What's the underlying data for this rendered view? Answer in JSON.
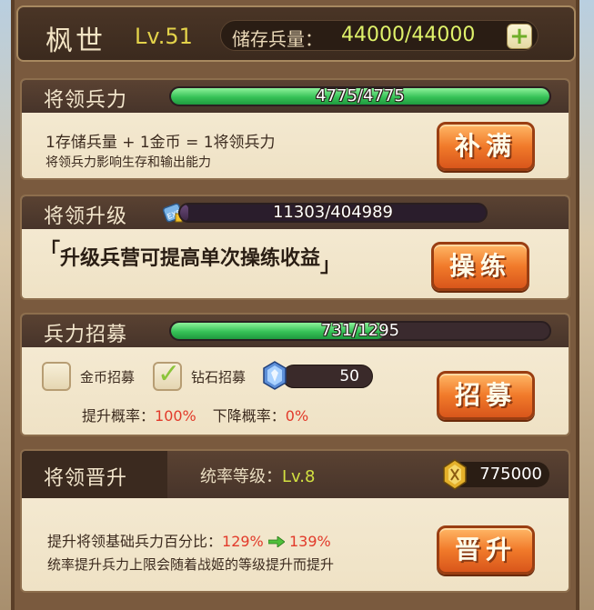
{
  "header": {
    "hero_name": "枫世",
    "level": "Lv.51",
    "storage_label": "储存兵量：",
    "storage_value": "44000/44000",
    "plus_icon": "plus-icon"
  },
  "troops": {
    "title": "将领兵力",
    "bar_text": "4775/4775",
    "bar_fraction": 1.0,
    "line1": "1存储兵量 + 1金币 = 1将领兵力",
    "line2": "将领兵力影响生存和输出能力",
    "button": "补满"
  },
  "upgrade": {
    "title": "将领升级",
    "exp_icon": "exp-icon",
    "bar_text": "11303/404989",
    "bar_fraction": 0.028,
    "tip_open": "「",
    "tip": "升级兵营可提高单次操练收益",
    "tip_close": "」",
    "button": "操练"
  },
  "recruit": {
    "title": "兵力招募",
    "bar_text": "731/1295",
    "bar_fraction": 0.564,
    "gold_label": "金币招募",
    "gold_checked": false,
    "diamond_label": "钻石招募",
    "diamond_checked": true,
    "diamond_count": "50",
    "up_label": "提升概率：",
    "up_value": "100%",
    "down_label": "下降概率：",
    "down_value": "0%",
    "button": "招募"
  },
  "promote": {
    "title": "将领晋升",
    "command_label": "统率等级：",
    "command_value": "Lv.8",
    "coin_count": "775000",
    "line1_label": "提升将领基础兵力百分比：",
    "from": "129%",
    "to": "139%",
    "line2": "统率提升兵力上限会随着战姬的等级提升而提升",
    "button": "晋升"
  }
}
